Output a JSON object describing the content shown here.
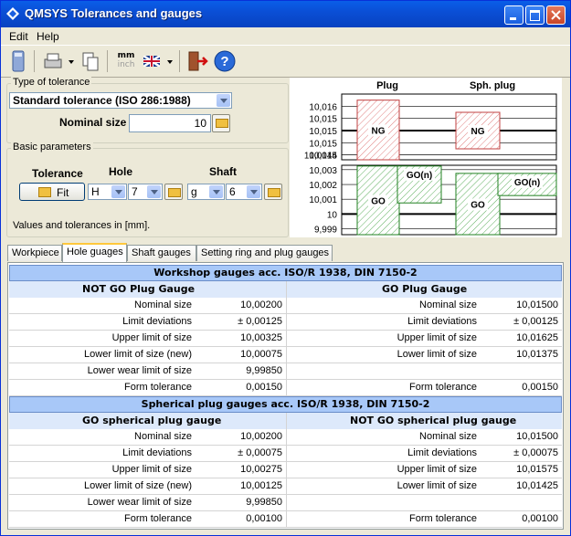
{
  "window": {
    "title": "QMSYS Tolerances and gauges"
  },
  "menu": [
    "Edit",
    "Help"
  ],
  "toolbar": {
    "icons": [
      "calculator-icon",
      "printer-icon",
      "copy-icon",
      "units-mm-inch-icon",
      "language-flag-icon",
      "exit-icon",
      "help-icon"
    ],
    "mm": "mm",
    "inch": "inch"
  },
  "tolerance_type": {
    "legend": "Type of tolerance",
    "selected": "Standard tolerance (ISO 286:1988)"
  },
  "nominal": {
    "label": "Nominal size",
    "value": "10"
  },
  "basic": {
    "legend": "Basic parameters",
    "tolerance_label": "Tolerance",
    "hole_label": "Hole",
    "shaft_label": "Shaft",
    "fit_label": "Fit",
    "hole_letter": "H",
    "hole_grade": "7",
    "shaft_letter": "g",
    "shaft_grade": "6",
    "units_note": "Values and tolerances in [mm]."
  },
  "chart_data": {
    "type": "bar",
    "columns": [
      "Plug",
      "Sph. plug"
    ],
    "upper_axis": {
      "ticks": [
        "10,016",
        "10,015",
        "10,0155",
        "10,015",
        "10,0145",
        "10,014"
      ],
      "range": [
        10.0138,
        10.0165
      ]
    },
    "lower_axis": {
      "ticks": [
        "10,003",
        "10,002",
        "10,001",
        "10",
        "9,999"
      ],
      "range": [
        9.9986,
        10.0033
      ]
    },
    "boxes": [
      {
        "label": "NG",
        "column": "Plug",
        "from": 10.01375,
        "to": 10.01625,
        "color": "#d06060"
      },
      {
        "label": "GO",
        "column": "Plug",
        "from": 9.9985,
        "to": 10.00325,
        "color": "#40a040"
      },
      {
        "label": "GO(n)",
        "column": "Plug",
        "from": 10.00075,
        "to": 10.00325,
        "color": "#40a040"
      },
      {
        "label": "NG",
        "column": "Sph. plug",
        "from": 10.01425,
        "to": 10.01575,
        "color": "#d06060"
      },
      {
        "label": "GO",
        "column": "Sph. plug",
        "from": 9.9985,
        "to": 10.00275,
        "color": "#40a040"
      },
      {
        "label": "GO(n)",
        "column": "Sph. plug",
        "from": 10.00125,
        "to": 10.00275,
        "color": "#40a040"
      }
    ]
  },
  "tabs": [
    "Workpiece",
    "Hole guages",
    "Shaft gauges",
    "Setting ring and plug gauges"
  ],
  "active_tab": 1,
  "sections": [
    {
      "header": "Workshop gauges acc. ISO/R 1938, DIN 7150-2",
      "left_title": "NOT GO Plug Gauge",
      "right_title": "GO Plug Gauge",
      "rows": [
        [
          "Nominal size",
          "10,00200",
          "Nominal size",
          "10,01500"
        ],
        [
          "Limit deviations",
          "± 0,00125",
          "Limit deviations",
          "± 0,00125"
        ],
        [
          "Upper limit of size",
          "10,00325",
          "Upper limit of size",
          "10,01625"
        ],
        [
          "Lower limit of size (new)",
          "10,00075",
          "Lower limit of size",
          "10,01375"
        ],
        [
          "Lower wear limit of size",
          "9,99850",
          "",
          ""
        ],
        [
          "Form tolerance",
          "0,00150",
          "Form tolerance",
          "0,00150"
        ]
      ]
    },
    {
      "header": "Spherical plug gauges acc. ISO/R 1938, DIN 7150-2",
      "left_title": "GO spherical plug gauge",
      "right_title": "NOT GO spherical plug gauge",
      "rows": [
        [
          "Nominal size",
          "10,00200",
          "Nominal size",
          "10,01500"
        ],
        [
          "Limit deviations",
          "± 0,00075",
          "Limit deviations",
          "± 0,00075"
        ],
        [
          "Upper limit of size",
          "10,00275",
          "Upper limit of size",
          "10,01575"
        ],
        [
          "Lower limit of size (new)",
          "10,00125",
          "Lower limit of size",
          "10,01425"
        ],
        [
          "Lower wear limit of size",
          "9,99850",
          "",
          ""
        ],
        [
          "Form tolerance",
          "0,00100",
          "Form tolerance",
          "0,00100"
        ]
      ]
    }
  ]
}
